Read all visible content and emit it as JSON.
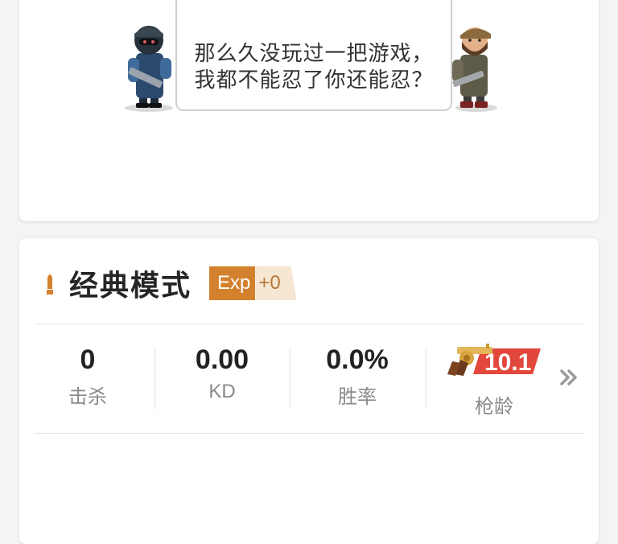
{
  "speech_bubble": {
    "text": "那么久没玩过一把游戏，我都不能忍了你还能忍？"
  },
  "mode": {
    "title": "经典模式",
    "exp_label": "Exp",
    "exp_value": "+0"
  },
  "stats": [
    {
      "value": "0",
      "label": "击杀"
    },
    {
      "value": "0.00",
      "label": "KD"
    },
    {
      "value": "0.0%",
      "label": "胜率"
    }
  ],
  "gun_age": {
    "value": "10.1",
    "label": "枪龄"
  },
  "colors": {
    "accent_orange": "#d4812e",
    "exp_bg": "#f6e6d2",
    "gun_red": "#e2473b"
  },
  "icons": [
    "soldier-left-avatar",
    "soldier-right-avatar",
    "bullet-icon",
    "revolver-icon",
    "chevron-right-icon"
  ]
}
